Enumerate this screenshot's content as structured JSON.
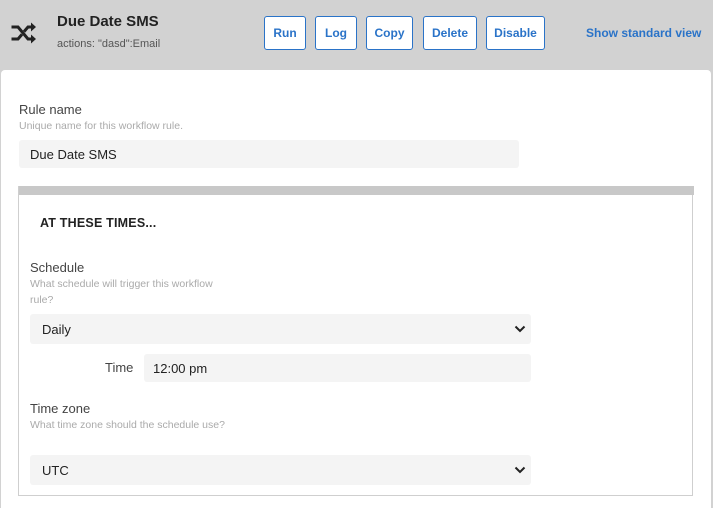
{
  "header": {
    "title": "Due Date SMS",
    "subtitle": "actions: \"dasd\":Email",
    "icon": "shuffle-icon",
    "buttons": {
      "run": "Run",
      "log": "Log",
      "copy": "Copy",
      "delete": "Delete",
      "disable": "Disable"
    },
    "standard_view_link": "Show standard view",
    "accent_color": "#2a73c8"
  },
  "rule_name": {
    "label": "Rule name",
    "hint": "Unique name for this workflow rule.",
    "value": "Due Date SMS"
  },
  "section": {
    "heading": "AT THESE TIMES...",
    "schedule": {
      "label": "Schedule",
      "hint": "What schedule will trigger this workflow rule?",
      "selected": "Daily"
    },
    "time": {
      "label": "Time",
      "value": "12:00 pm"
    },
    "timezone": {
      "label": "Time zone",
      "hint": "What time zone should the schedule use?",
      "selected": "UTC"
    }
  }
}
